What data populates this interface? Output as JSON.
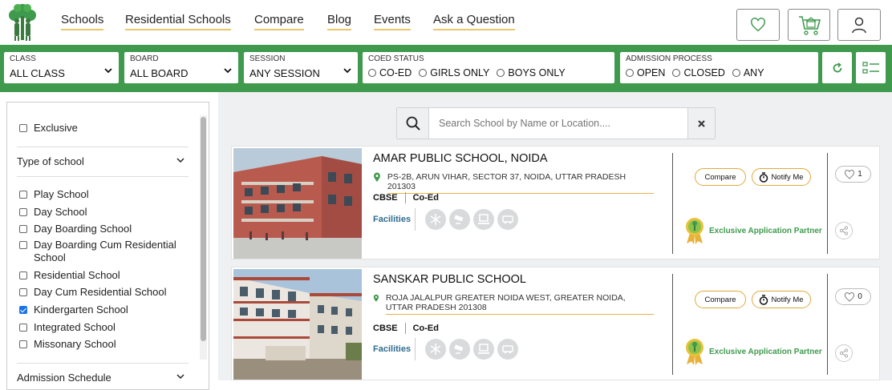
{
  "nav": {
    "items": [
      "Schools",
      "Residential Schools",
      "Compare",
      "Blog",
      "Events",
      "Ask a Question"
    ]
  },
  "header_icons": {
    "wishlist": "heart-icon",
    "cart": "school-cart-icon",
    "account": "user-icon"
  },
  "filters": {
    "class": {
      "label": "CLASS",
      "value": "ALL CLASS"
    },
    "board": {
      "label": "BOARD",
      "value": "ALL BOARD"
    },
    "session": {
      "label": "SESSION",
      "value": "ANY SESSION"
    },
    "coed": {
      "label": "COED STATUS",
      "options": [
        "CO-ED",
        "GIRLS ONLY",
        "BOYS ONLY"
      ]
    },
    "admission": {
      "label": "ADMISSION PROCESS",
      "options": [
        "OPEN",
        "CLOSED",
        "ANY"
      ]
    }
  },
  "sidebar": {
    "exclusive": "Exclusive",
    "type_heading": "Type of school",
    "types": [
      {
        "label": "Play School",
        "checked": false
      },
      {
        "label": "Day School",
        "checked": false
      },
      {
        "label": "Day Boarding School",
        "checked": false
      },
      {
        "label": "Day Boarding Cum Residential School",
        "checked": false
      },
      {
        "label": "Residential School",
        "checked": false
      },
      {
        "label": "Day Cum Residential School",
        "checked": false
      },
      {
        "label": "Kindergarten School",
        "checked": true
      },
      {
        "label": "Integrated School",
        "checked": false
      },
      {
        "label": "Missonary School",
        "checked": false
      }
    ],
    "schedule_heading": "Admission Schedule"
  },
  "search": {
    "placeholder": "Search School by Name or Location...."
  },
  "schools": [
    {
      "name": "AMAR PUBLIC SCHOOL, NOIDA",
      "address": "PS-2B, ARUN VIHAR, SECTOR 37, NOIDA, UTTAR PRADESH 201303",
      "board": "CBSE",
      "coed": "Co-Ed",
      "facilities_label": "Facilities",
      "compare": "Compare",
      "notify": "Notify Me",
      "partner": "Exclusive Application Partner",
      "likes": "1"
    },
    {
      "name": "SANSKAR PUBLIC SCHOOL",
      "address": "ROJA JALALPUR GREATER NOIDA WEST, GREATER NOIDA, UTTAR PRADESH 201308",
      "board": "CBSE",
      "coed": "Co-Ed",
      "facilities_label": "Facilities",
      "compare": "Compare",
      "notify": "Notify Me",
      "partner": "Exclusive Application Partner",
      "likes": "0"
    }
  ],
  "colors": {
    "brand_green": "#3f9a4e",
    "accent_gold": "#e8c86a"
  }
}
